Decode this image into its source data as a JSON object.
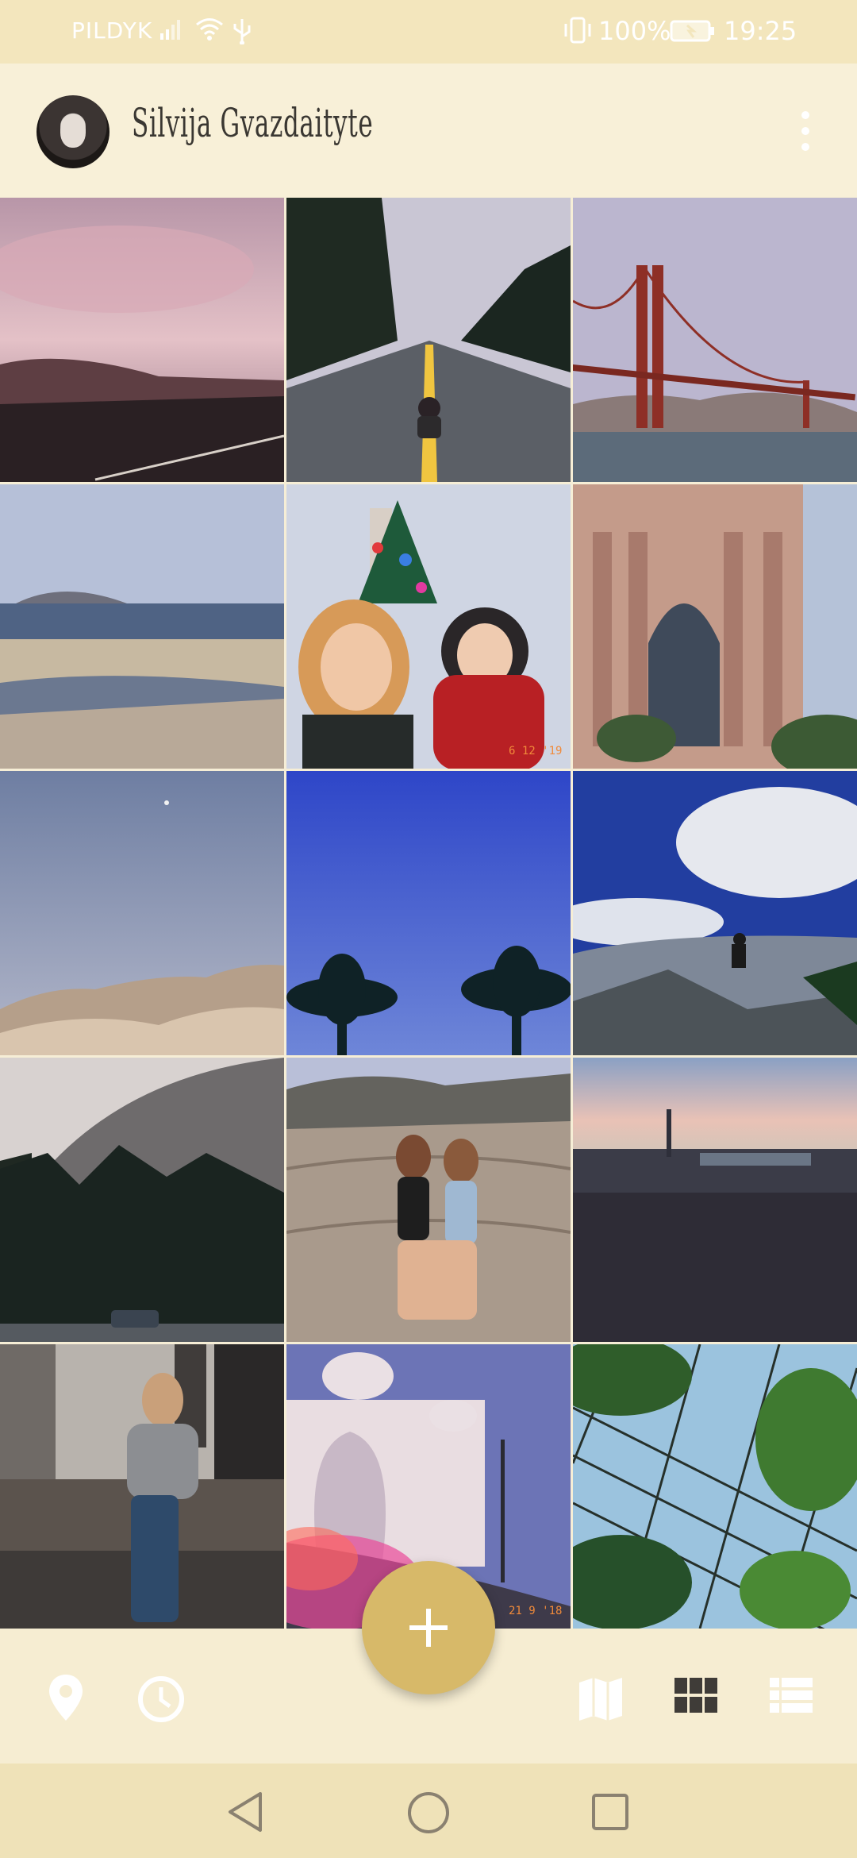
{
  "status_bar": {
    "carrier": "PILDYK",
    "battery": "100%",
    "time": "19:25",
    "icons": [
      "signal-icon",
      "wifi-icon",
      "usb-icon",
      "vibrate-icon",
      "battery-icon"
    ]
  },
  "header": {
    "profile_name": "Silvija Gvazdaityte",
    "menu_icon": "more-vert-icon"
  },
  "photos": [
    {
      "name": "photo-pink-clouds-hills"
    },
    {
      "name": "photo-road-person-sitting"
    },
    {
      "name": "photo-golden-gate-bridge"
    },
    {
      "name": "photo-beach-bay"
    },
    {
      "name": "photo-selfie-christmas-tree",
      "stamp": "6 12 '19"
    },
    {
      "name": "photo-palace-of-fine-arts"
    },
    {
      "name": "photo-desert-dunes-moon"
    },
    {
      "name": "photo-palm-trees-blue-sky"
    },
    {
      "name": "photo-person-on-rock-clouds"
    },
    {
      "name": "photo-yosemite-cliff-forest"
    },
    {
      "name": "photo-two-girls-on-rocks"
    },
    {
      "name": "photo-city-skyline-sunset"
    },
    {
      "name": "photo-girl-on-wall-city"
    },
    {
      "name": "photo-church-light-leak",
      "stamp": "21 9 '18"
    },
    {
      "name": "photo-greenhouse-leaves"
    }
  ],
  "fab": {
    "label": "+",
    "icon": "add-icon"
  },
  "bottom_bar": {
    "left": [
      "location-pin-icon",
      "clock-icon"
    ],
    "right": [
      "map-icon",
      "grid-view-icon",
      "list-view-icon"
    ]
  },
  "nav_bar": [
    "back-icon",
    "home-icon",
    "recents-icon"
  ],
  "colors": {
    "accent": "#d7b969",
    "header_bg": "#f8f0d8",
    "status_bg": "#f3e6bd",
    "nav_bg": "#efe2b8"
  }
}
